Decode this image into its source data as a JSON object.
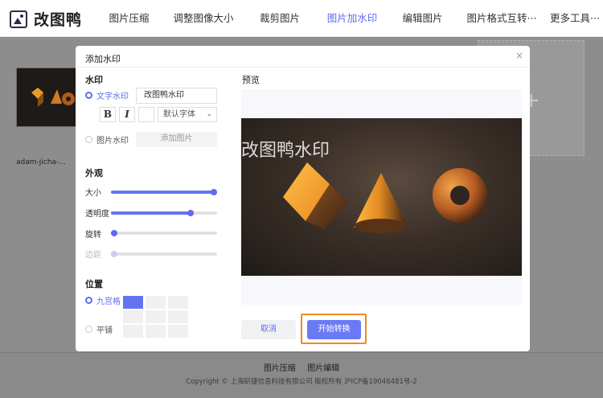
{
  "header": {
    "logo_text": "改图鸭",
    "nav": [
      {
        "label": "图片压缩",
        "active": false
      },
      {
        "label": "调整图像大小",
        "active": false
      },
      {
        "label": "裁剪图片",
        "active": false
      },
      {
        "label": "图片加水印",
        "active": true
      },
      {
        "label": "编辑图片",
        "active": false
      },
      {
        "label": "图片格式互转···",
        "active": false
      },
      {
        "label": "更多工具···",
        "active": false
      }
    ]
  },
  "background": {
    "thumb_label": "adam-jicha-...",
    "add_plus": "+"
  },
  "footer": {
    "link_compress": "图片压缩",
    "link_edit": "图片编辑",
    "copyright": "Copyright © 上海斫捷信息科技有限公司 版权所有 沪ICP备19046481号-2"
  },
  "modal": {
    "title": "添加水印",
    "close_glyph": "×",
    "watermark_section": "水印",
    "text_wm_label": "文字水印",
    "text_wm_value": "改图鸭水印",
    "bold_glyph": "B",
    "italic_glyph": "I",
    "font_select_value": "默认字体",
    "chevron_glyph": "⌄",
    "image_wm_label": "图片水印",
    "add_image_label": "添加图片",
    "appearance_section": "外观",
    "sliders": [
      {
        "label": "大小",
        "value": 1.0,
        "disabled": false
      },
      {
        "label": "透明度",
        "value": 0.77,
        "disabled": false
      },
      {
        "label": "旋转",
        "value": 0.0,
        "disabled": false
      },
      {
        "label": "边距",
        "value": 0.0,
        "disabled": true
      }
    ],
    "position_section": "位置",
    "grid_label": "九宫格",
    "tile_label": "平铺",
    "preview_title": "预览",
    "preview_watermark": "改图鸭水印",
    "cancel_label": "取消",
    "start_label": "开始转换"
  },
  "colors": {
    "accent": "#5b6cf0",
    "highlight_outline": "#f08a1f"
  }
}
